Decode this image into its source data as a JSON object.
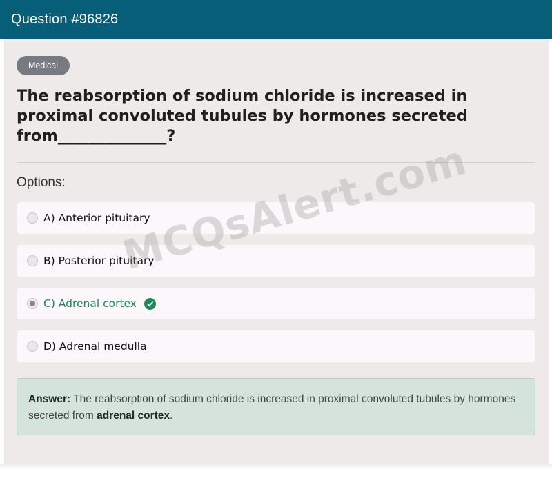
{
  "header": {
    "title": "Question #96826"
  },
  "badge": {
    "label": "Medical"
  },
  "question": {
    "text": "The reabsorption of sodium chloride is increased in proximal convoluted tubules by hormones secreted from______________?"
  },
  "options_label": "Options:",
  "options": [
    {
      "label": "A) Anterior pituitary",
      "selected": false,
      "correct": false
    },
    {
      "label": "B) Posterior pituitary",
      "selected": false,
      "correct": false
    },
    {
      "label": "C) Adrenal cortex",
      "selected": true,
      "correct": true
    },
    {
      "label": "D) Adrenal medulla",
      "selected": false,
      "correct": false
    }
  ],
  "watermark": "MCQsAlert.com",
  "answer": {
    "prefix": "Answer:",
    "text": "The reabsorption of sodium chloride is increased in proximal convoluted tubules by hormones secreted from",
    "highlight": "adrenal cortex",
    "suffix": "."
  },
  "colors": {
    "header_bg": "#075e79",
    "correct": "#1e8a52",
    "answer_bg": "#d4e4da",
    "badge_bg": "#777a80"
  },
  "icons": {
    "correct_indicator": "check-circle-icon"
  }
}
